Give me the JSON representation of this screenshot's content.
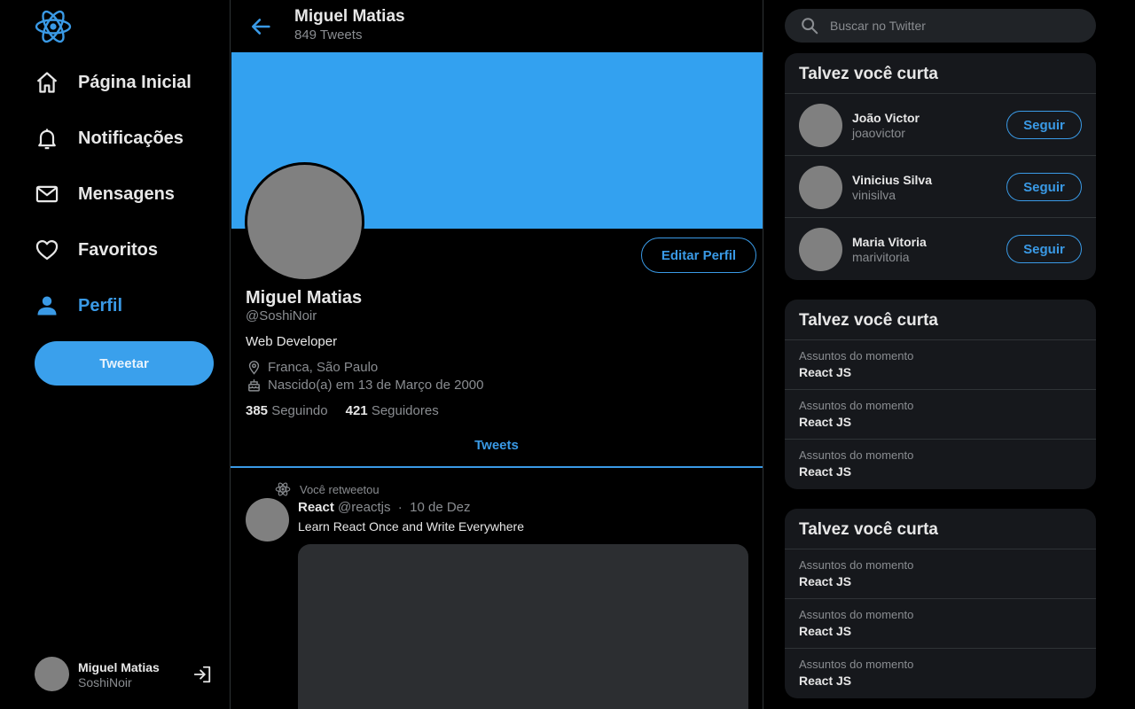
{
  "colors": {
    "accent": "#3a9ae6",
    "banner": "#33a1f0",
    "background": "#000000",
    "card": "#16181c"
  },
  "sidebar": {
    "logo_icon": "react-atom-icon",
    "items": [
      {
        "label": "Página Inicial",
        "icon": "home-icon",
        "active": false
      },
      {
        "label": "Notificações",
        "icon": "bell-icon",
        "active": false
      },
      {
        "label": "Mensagens",
        "icon": "mail-icon",
        "active": false
      },
      {
        "label": "Favoritos",
        "icon": "heart-icon",
        "active": false
      },
      {
        "label": "Perfil",
        "icon": "person-icon",
        "active": true
      }
    ],
    "tweet_button": "Tweetar",
    "user": {
      "name": "Miguel Matias",
      "handle": "SoshiNoir",
      "logout_icon": "logout-icon"
    }
  },
  "header": {
    "name": "Miguel Matias",
    "tweet_count": "849 Tweets"
  },
  "profile": {
    "edit_button": "Editar Perfil",
    "name": "Miguel Matias",
    "handle": "@SoshiNoir",
    "bio": "Web Developer",
    "location": "Franca, São Paulo",
    "birthday": "Nascido(a) em 13 de Março de 2000",
    "following_count": "385",
    "following_label": "Seguindo",
    "followers_count": "421",
    "followers_label": "Seguidores"
  },
  "tabs": {
    "active": "Tweets"
  },
  "tweet": {
    "retweet_label": "Você retweetou",
    "author": "React",
    "handle": "@reactjs",
    "separator": "·",
    "date": "10 de Dez",
    "text": "Learn React Once and Write Everywhere"
  },
  "search": {
    "placeholder": "Buscar no Twitter"
  },
  "follow_card": {
    "title": "Talvez você curta",
    "button": "Seguir",
    "users": [
      {
        "name": "João Victor",
        "handle": "joaovictor"
      },
      {
        "name": "Vinicius Silva",
        "handle": "vinisilva"
      },
      {
        "name": "Maria Vitoria",
        "handle": "marivitoria"
      }
    ]
  },
  "trend_cards": [
    {
      "title": "Talvez você curta",
      "items": [
        {
          "label": "Assuntos do momento",
          "topic": "React JS"
        },
        {
          "label": "Assuntos do momento",
          "topic": "React JS"
        },
        {
          "label": "Assuntos do momento",
          "topic": "React JS"
        }
      ]
    },
    {
      "title": "Talvez você curta",
      "items": [
        {
          "label": "Assuntos do momento",
          "topic": "React JS"
        },
        {
          "label": "Assuntos do momento",
          "topic": "React JS"
        },
        {
          "label": "Assuntos do momento",
          "topic": "React JS"
        }
      ]
    }
  ]
}
